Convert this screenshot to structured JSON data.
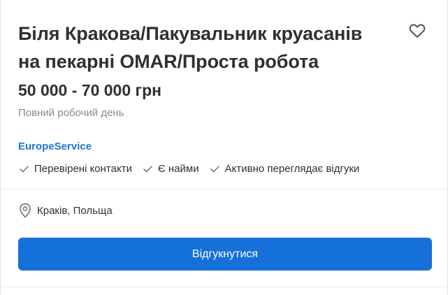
{
  "vacancy": {
    "title_line1": "Біля Кракова/Пакувальник круасанів",
    "title_line2": "на пекарні OMAR/Проста робота",
    "salary": "50 000 - 70 000 грн",
    "schedule": "Повний робочий день",
    "company": "EuropeService",
    "badges": [
      {
        "label": "Перевірені контакти",
        "icon": "check-icon"
      },
      {
        "label": "Є найми",
        "icon": "check-icon"
      },
      {
        "label": "Активно переглядає відгуки",
        "icon": "check-icon"
      }
    ],
    "location": "Краків, Польща",
    "apply_label": "Відгукнутися",
    "favorite_icon": "heart-icon"
  },
  "colors": {
    "accent": "#1670d9",
    "company_link": "#1f74d6",
    "muted_text": "#8a8a8a",
    "primary_text": "#303030"
  }
}
